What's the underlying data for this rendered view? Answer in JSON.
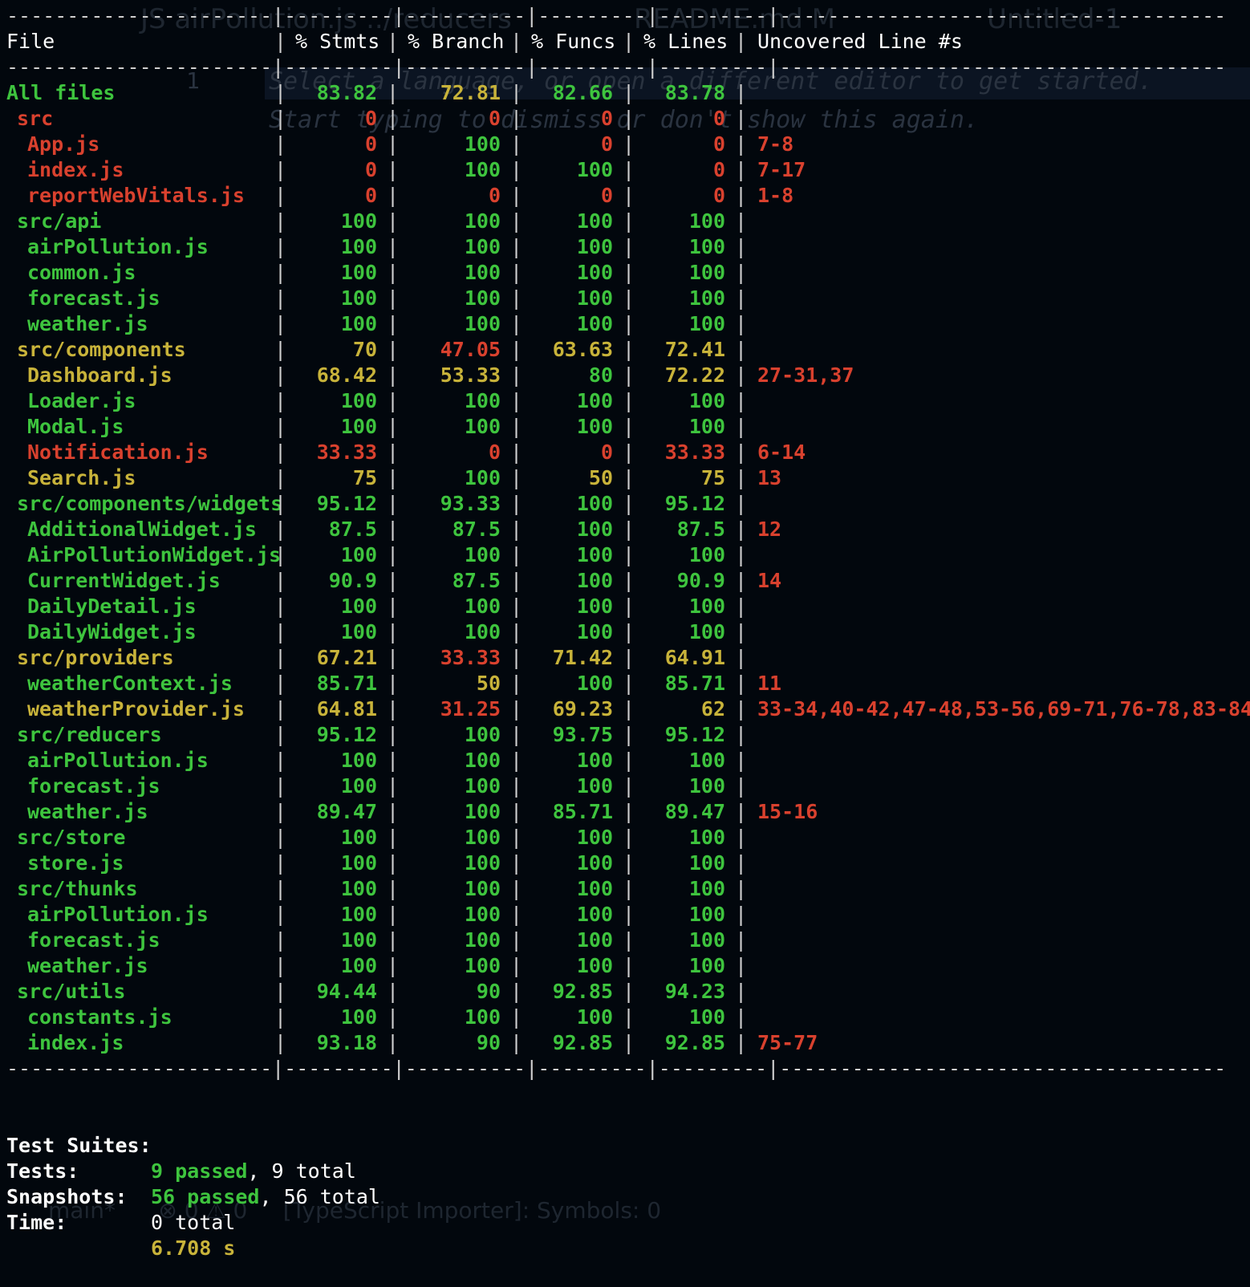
{
  "background_hints": {
    "tab1": "JS airPollution.js ../reducers",
    "tab2": "README.md M",
    "tab3": "Untitled-1",
    "line_no": "1",
    "hint_line1": "Select a language, or open a different editor to get started.",
    "hint_line2": "Start typing to dismiss or don't show this again.",
    "status": "main*      ⊗ 0 ⚠ 0     [TypeScript Importer]: Symbols: 0"
  },
  "header": {
    "file": "File",
    "stmts": "% Stmts",
    "branch": "% Branch",
    "funcs": "% Funcs",
    "lines": "% Lines",
    "uncovered": "Uncovered Line #s"
  },
  "rows": [
    {
      "name": "All files",
      "indent": 0,
      "stmts": "83.82",
      "branch": "72.81",
      "funcs": "82.66",
      "lines": "83.78",
      "uncovered": "",
      "nameColor": "green",
      "cols": [
        "green",
        "yellow",
        "green",
        "green"
      ]
    },
    {
      "name": "src",
      "indent": 1,
      "stmts": "0",
      "branch": "0",
      "funcs": "0",
      "lines": "0",
      "uncovered": "",
      "nameColor": "red",
      "cols": [
        "red",
        "red",
        "red",
        "red"
      ]
    },
    {
      "name": "App.js",
      "indent": 2,
      "stmts": "0",
      "branch": "100",
      "funcs": "0",
      "lines": "0",
      "uncovered": "7-8",
      "nameColor": "red",
      "cols": [
        "red",
        "green",
        "red",
        "red"
      ]
    },
    {
      "name": "index.js",
      "indent": 2,
      "stmts": "0",
      "branch": "100",
      "funcs": "100",
      "lines": "0",
      "uncovered": "7-17",
      "nameColor": "red",
      "cols": [
        "red",
        "green",
        "green",
        "red"
      ]
    },
    {
      "name": "reportWebVitals.js",
      "indent": 2,
      "stmts": "0",
      "branch": "0",
      "funcs": "0",
      "lines": "0",
      "uncovered": "1-8",
      "nameColor": "red",
      "cols": [
        "red",
        "red",
        "red",
        "red"
      ]
    },
    {
      "name": "src/api",
      "indent": 1,
      "stmts": "100",
      "branch": "100",
      "funcs": "100",
      "lines": "100",
      "uncovered": "",
      "nameColor": "green",
      "cols": [
        "green",
        "green",
        "green",
        "green"
      ]
    },
    {
      "name": "airPollution.js",
      "indent": 2,
      "stmts": "100",
      "branch": "100",
      "funcs": "100",
      "lines": "100",
      "uncovered": "",
      "nameColor": "green",
      "cols": [
        "green",
        "green",
        "green",
        "green"
      ]
    },
    {
      "name": "common.js",
      "indent": 2,
      "stmts": "100",
      "branch": "100",
      "funcs": "100",
      "lines": "100",
      "uncovered": "",
      "nameColor": "green",
      "cols": [
        "green",
        "green",
        "green",
        "green"
      ]
    },
    {
      "name": "forecast.js",
      "indent": 2,
      "stmts": "100",
      "branch": "100",
      "funcs": "100",
      "lines": "100",
      "uncovered": "",
      "nameColor": "green",
      "cols": [
        "green",
        "green",
        "green",
        "green"
      ]
    },
    {
      "name": "weather.js",
      "indent": 2,
      "stmts": "100",
      "branch": "100",
      "funcs": "100",
      "lines": "100",
      "uncovered": "",
      "nameColor": "green",
      "cols": [
        "green",
        "green",
        "green",
        "green"
      ]
    },
    {
      "name": "src/components",
      "indent": 1,
      "stmts": "70",
      "branch": "47.05",
      "funcs": "63.63",
      "lines": "72.41",
      "uncovered": "",
      "nameColor": "yellow",
      "cols": [
        "yellow",
        "red",
        "yellow",
        "yellow"
      ]
    },
    {
      "name": "Dashboard.js",
      "indent": 2,
      "stmts": "68.42",
      "branch": "53.33",
      "funcs": "80",
      "lines": "72.22",
      "uncovered": "27-31,37",
      "nameColor": "yellow",
      "cols": [
        "yellow",
        "yellow",
        "green",
        "yellow"
      ]
    },
    {
      "name": "Loader.js",
      "indent": 2,
      "stmts": "100",
      "branch": "100",
      "funcs": "100",
      "lines": "100",
      "uncovered": "",
      "nameColor": "green",
      "cols": [
        "green",
        "green",
        "green",
        "green"
      ]
    },
    {
      "name": "Modal.js",
      "indent": 2,
      "stmts": "100",
      "branch": "100",
      "funcs": "100",
      "lines": "100",
      "uncovered": "",
      "nameColor": "green",
      "cols": [
        "green",
        "green",
        "green",
        "green"
      ]
    },
    {
      "name": "Notification.js",
      "indent": 2,
      "stmts": "33.33",
      "branch": "0",
      "funcs": "0",
      "lines": "33.33",
      "uncovered": "6-14",
      "nameColor": "red",
      "cols": [
        "red",
        "red",
        "red",
        "red"
      ]
    },
    {
      "name": "Search.js",
      "indent": 2,
      "stmts": "75",
      "branch": "100",
      "funcs": "50",
      "lines": "75",
      "uncovered": "13",
      "nameColor": "yellow",
      "cols": [
        "yellow",
        "green",
        "yellow",
        "yellow"
      ]
    },
    {
      "name": "src/components/widgets",
      "indent": 1,
      "stmts": "95.12",
      "branch": "93.33",
      "funcs": "100",
      "lines": "95.12",
      "uncovered": "",
      "nameColor": "green",
      "cols": [
        "green",
        "green",
        "green",
        "green"
      ]
    },
    {
      "name": "AdditionalWidget.js",
      "indent": 2,
      "stmts": "87.5",
      "branch": "87.5",
      "funcs": "100",
      "lines": "87.5",
      "uncovered": "12",
      "nameColor": "green",
      "cols": [
        "green",
        "green",
        "green",
        "green"
      ]
    },
    {
      "name": "AirPollutionWidget.js",
      "indent": 2,
      "stmts": "100",
      "branch": "100",
      "funcs": "100",
      "lines": "100",
      "uncovered": "",
      "nameColor": "green",
      "cols": [
        "green",
        "green",
        "green",
        "green"
      ]
    },
    {
      "name": "CurrentWidget.js",
      "indent": 2,
      "stmts": "90.9",
      "branch": "87.5",
      "funcs": "100",
      "lines": "90.9",
      "uncovered": "14",
      "nameColor": "green",
      "cols": [
        "green",
        "green",
        "green",
        "green"
      ]
    },
    {
      "name": "DailyDetail.js",
      "indent": 2,
      "stmts": "100",
      "branch": "100",
      "funcs": "100",
      "lines": "100",
      "uncovered": "",
      "nameColor": "green",
      "cols": [
        "green",
        "green",
        "green",
        "green"
      ]
    },
    {
      "name": "DailyWidget.js",
      "indent": 2,
      "stmts": "100",
      "branch": "100",
      "funcs": "100",
      "lines": "100",
      "uncovered": "",
      "nameColor": "green",
      "cols": [
        "green",
        "green",
        "green",
        "green"
      ]
    },
    {
      "name": "src/providers",
      "indent": 1,
      "stmts": "67.21",
      "branch": "33.33",
      "funcs": "71.42",
      "lines": "64.91",
      "uncovered": "",
      "nameColor": "yellow",
      "cols": [
        "yellow",
        "red",
        "yellow",
        "yellow"
      ]
    },
    {
      "name": "weatherContext.js",
      "indent": 2,
      "stmts": "85.71",
      "branch": "50",
      "funcs": "100",
      "lines": "85.71",
      "uncovered": "11",
      "nameColor": "green",
      "cols": [
        "green",
        "yellow",
        "green",
        "green"
      ]
    },
    {
      "name": "weatherProvider.js",
      "indent": 2,
      "stmts": "64.81",
      "branch": "31.25",
      "funcs": "69.23",
      "lines": "62",
      "uncovered": "33-34,40-42,47-48,53-56,69-71,76-78,83-84",
      "nameColor": "yellow",
      "cols": [
        "yellow",
        "red",
        "yellow",
        "yellow"
      ]
    },
    {
      "name": "src/reducers",
      "indent": 1,
      "stmts": "95.12",
      "branch": "100",
      "funcs": "93.75",
      "lines": "95.12",
      "uncovered": "",
      "nameColor": "green",
      "cols": [
        "green",
        "green",
        "green",
        "green"
      ]
    },
    {
      "name": "airPollution.js",
      "indent": 2,
      "stmts": "100",
      "branch": "100",
      "funcs": "100",
      "lines": "100",
      "uncovered": "",
      "nameColor": "green",
      "cols": [
        "green",
        "green",
        "green",
        "green"
      ]
    },
    {
      "name": "forecast.js",
      "indent": 2,
      "stmts": "100",
      "branch": "100",
      "funcs": "100",
      "lines": "100",
      "uncovered": "",
      "nameColor": "green",
      "cols": [
        "green",
        "green",
        "green",
        "green"
      ]
    },
    {
      "name": "weather.js",
      "indent": 2,
      "stmts": "89.47",
      "branch": "100",
      "funcs": "85.71",
      "lines": "89.47",
      "uncovered": "15-16",
      "nameColor": "green",
      "cols": [
        "green",
        "green",
        "green",
        "green"
      ]
    },
    {
      "name": "src/store",
      "indent": 1,
      "stmts": "100",
      "branch": "100",
      "funcs": "100",
      "lines": "100",
      "uncovered": "",
      "nameColor": "green",
      "cols": [
        "green",
        "green",
        "green",
        "green"
      ]
    },
    {
      "name": "store.js",
      "indent": 2,
      "stmts": "100",
      "branch": "100",
      "funcs": "100",
      "lines": "100",
      "uncovered": "",
      "nameColor": "green",
      "cols": [
        "green",
        "green",
        "green",
        "green"
      ]
    },
    {
      "name": "src/thunks",
      "indent": 1,
      "stmts": "100",
      "branch": "100",
      "funcs": "100",
      "lines": "100",
      "uncovered": "",
      "nameColor": "green",
      "cols": [
        "green",
        "green",
        "green",
        "green"
      ]
    },
    {
      "name": "airPollution.js",
      "indent": 2,
      "stmts": "100",
      "branch": "100",
      "funcs": "100",
      "lines": "100",
      "uncovered": "",
      "nameColor": "green",
      "cols": [
        "green",
        "green",
        "green",
        "green"
      ]
    },
    {
      "name": "forecast.js",
      "indent": 2,
      "stmts": "100",
      "branch": "100",
      "funcs": "100",
      "lines": "100",
      "uncovered": "",
      "nameColor": "green",
      "cols": [
        "green",
        "green",
        "green",
        "green"
      ]
    },
    {
      "name": "weather.js",
      "indent": 2,
      "stmts": "100",
      "branch": "100",
      "funcs": "100",
      "lines": "100",
      "uncovered": "",
      "nameColor": "green",
      "cols": [
        "green",
        "green",
        "green",
        "green"
      ]
    },
    {
      "name": "src/utils",
      "indent": 1,
      "stmts": "94.44",
      "branch": "90",
      "funcs": "92.85",
      "lines": "94.23",
      "uncovered": "",
      "nameColor": "green",
      "cols": [
        "green",
        "green",
        "green",
        "green"
      ]
    },
    {
      "name": "constants.js",
      "indent": 2,
      "stmts": "100",
      "branch": "100",
      "funcs": "100",
      "lines": "100",
      "uncovered": "",
      "nameColor": "green",
      "cols": [
        "green",
        "green",
        "green",
        "green"
      ]
    },
    {
      "name": "index.js",
      "indent": 2,
      "stmts": "93.18",
      "branch": "90",
      "funcs": "92.85",
      "lines": "92.85",
      "uncovered": "75-77",
      "nameColor": "green",
      "cols": [
        "green",
        "green",
        "green",
        "green"
      ]
    }
  ],
  "summary": {
    "suites_label": "Test Suites:",
    "suites_passed": "9 passed",
    "suites_total": ", 9 total",
    "tests_label": "Tests:",
    "tests_passed": "56 passed",
    "tests_total": ", 56 total",
    "snapshots_label": "Snapshots:",
    "snapshots_value": "0 total",
    "time_label": "Time:",
    "time_value": "6.708 s"
  },
  "colors": {
    "green": "#3ec43e",
    "yellow": "#c8b33a",
    "red": "#d9412e",
    "background": "#02070d"
  }
}
